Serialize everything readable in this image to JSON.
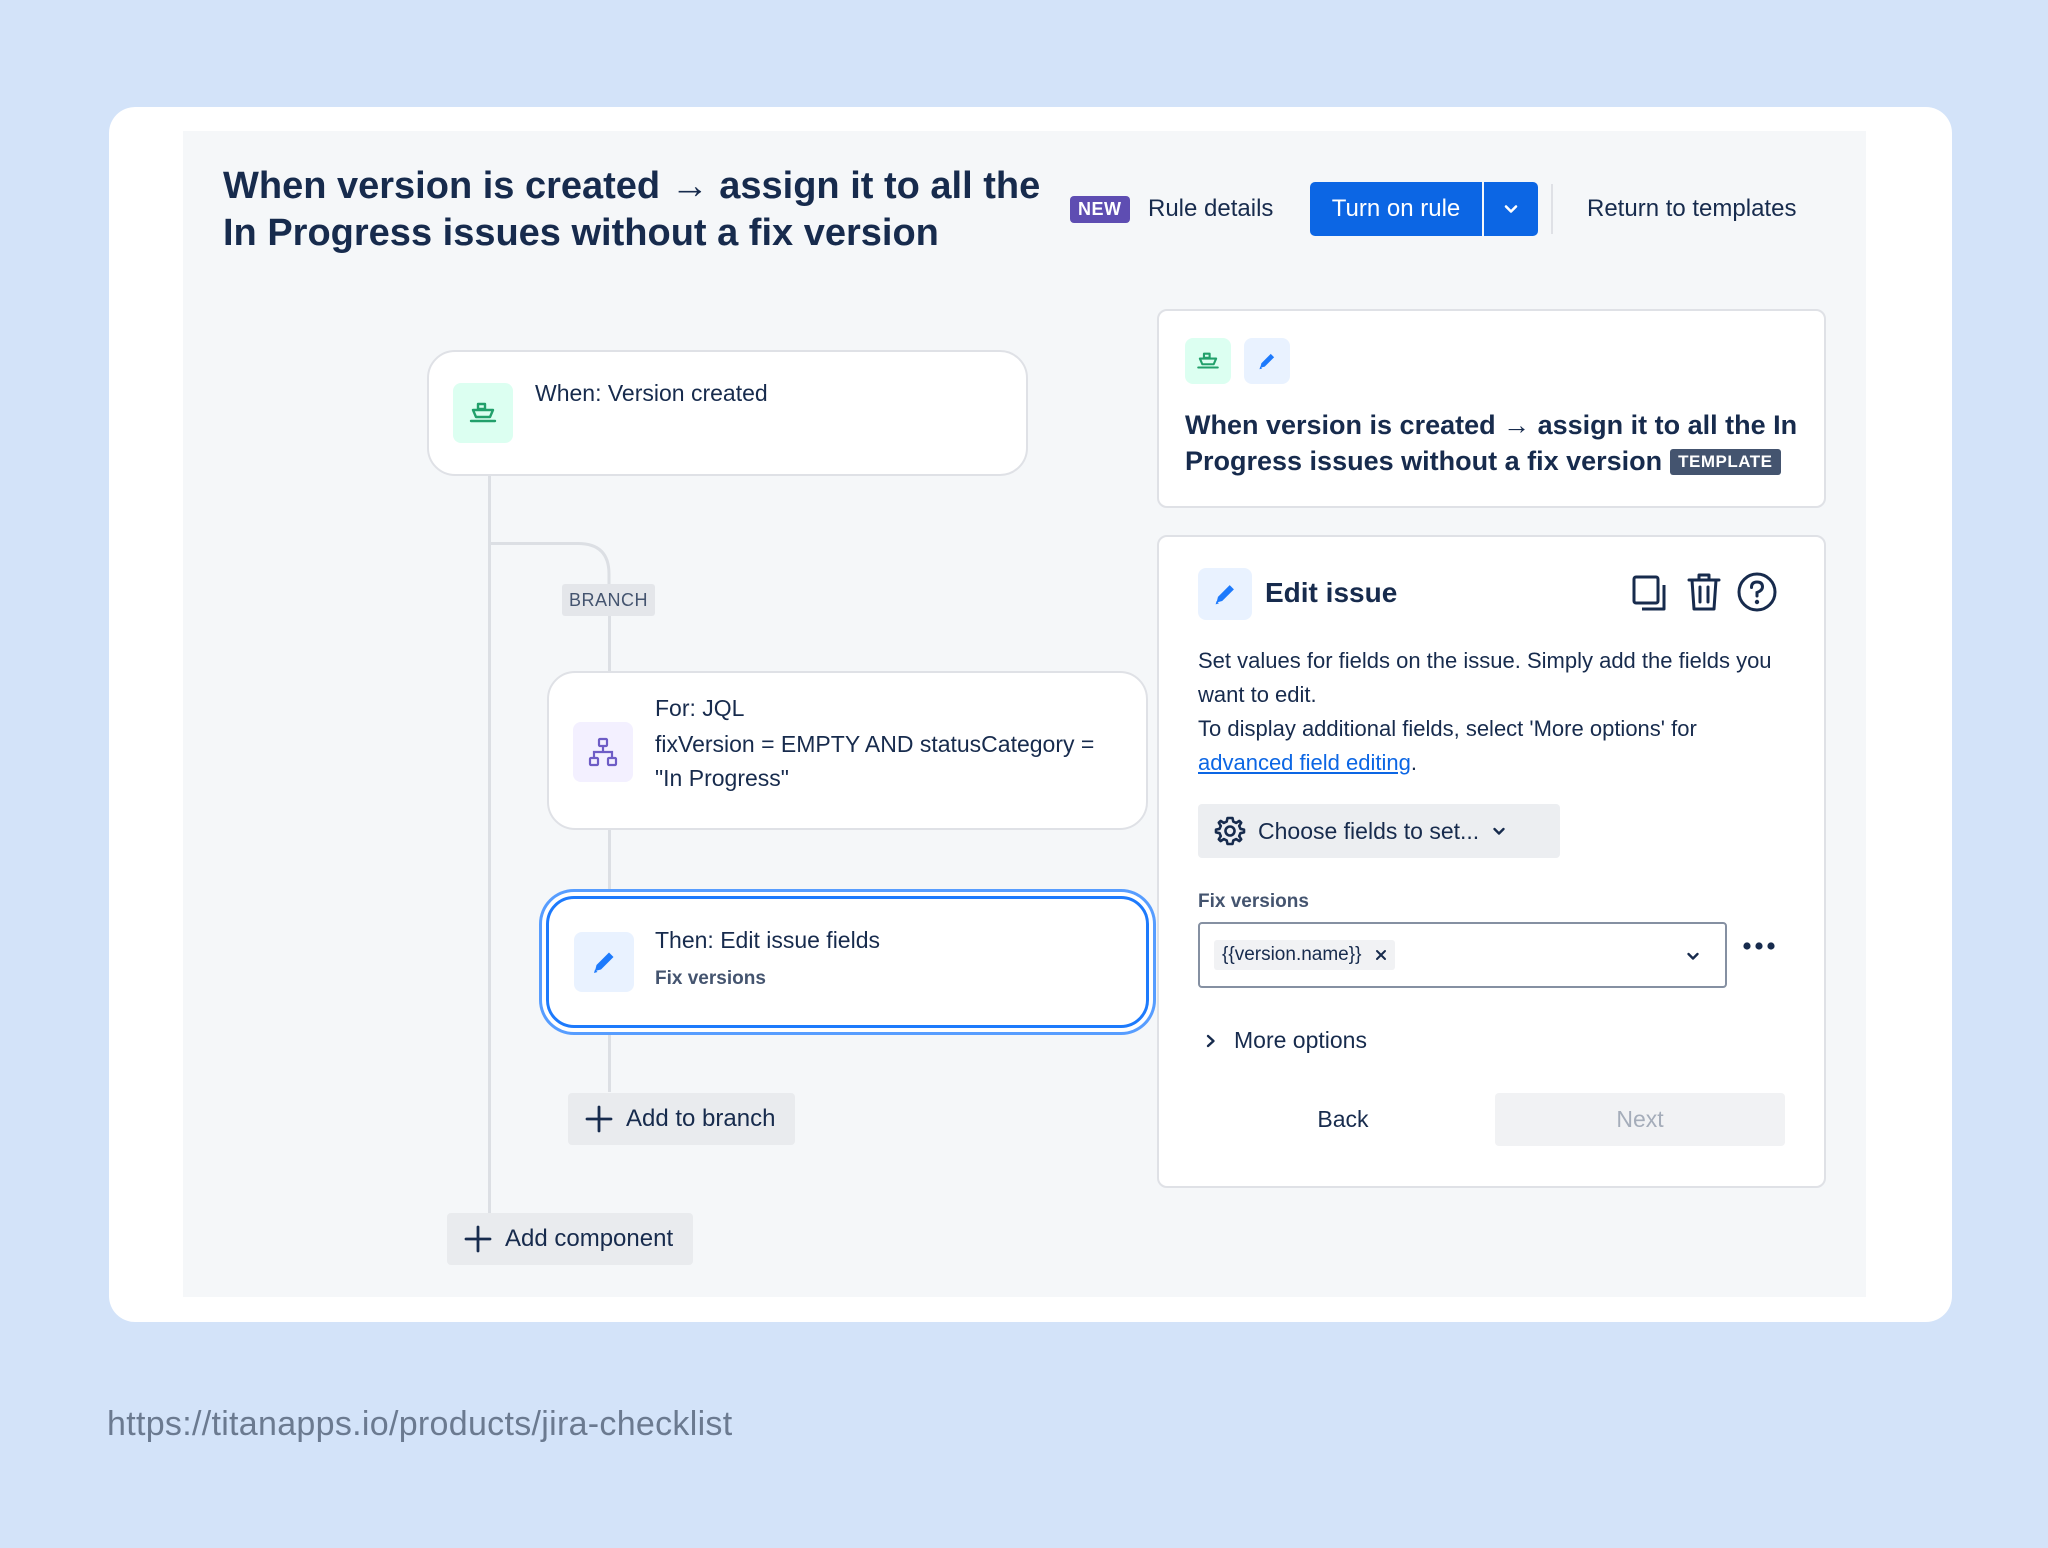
{
  "header": {
    "title": "When version is created → assign it to all the In Progress issues without a fix version",
    "new_badge": "NEW",
    "rule_details": "Rule details",
    "turn_on_rule": "Turn on rule",
    "return_to_templates": "Return to templates"
  },
  "flow": {
    "trigger": {
      "label": "When: Version created",
      "icon": "ship-icon"
    },
    "branch_tag": "BRANCH",
    "branch": {
      "title": "For: JQL",
      "query": "fixVersion = EMPTY AND statusCategory = \"In Progress\"",
      "icon": "hierarchy-icon"
    },
    "action": {
      "title": "Then: Edit issue fields",
      "subtitle": "Fix versions",
      "icon": "pencil-icon"
    },
    "add_to_branch": "Add to branch",
    "add_component": "Add component"
  },
  "template_panel": {
    "title": "When version is created → assign it to all the In Progress issues without a fix version",
    "badge": "TEMPLATE"
  },
  "edit_panel": {
    "title": "Edit issue",
    "desc_line1": "Set values for fields on the issue. Simply add the fields you want to edit.",
    "desc_line2": "To display additional fields, select 'More options' for",
    "desc_link": "advanced field editing",
    "desc_end": ".",
    "choose_fields": "Choose fields to set...",
    "field_label": "Fix versions",
    "field_value": "{{version.name}}",
    "more_options": "More options",
    "back": "Back",
    "next": "Next"
  },
  "footer_url": "https://titanapps.io/products/jira-checklist",
  "colors": {
    "primary": "#0c66e4",
    "new_badge": "#5e4db2",
    "selection": "#1d7afc"
  }
}
